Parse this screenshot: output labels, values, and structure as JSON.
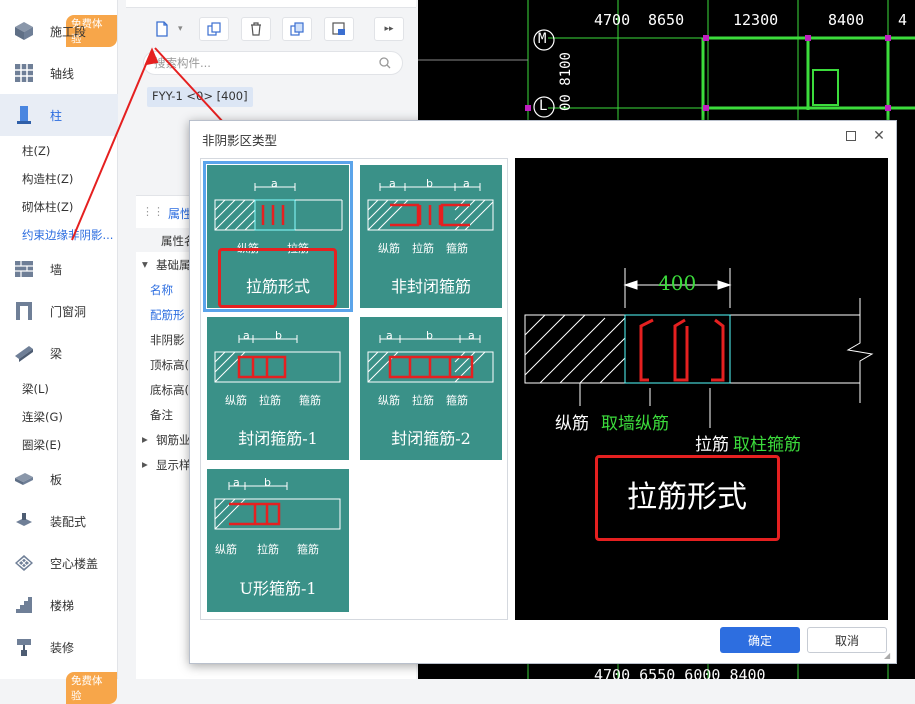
{
  "nav": {
    "badge_top": "免费体验",
    "badge_bottom": "免费体验",
    "items": [
      {
        "label": "施工段",
        "icon": "construction-section-icon"
      },
      {
        "label": "轴线",
        "icon": "axis-grid-icon"
      },
      {
        "label": "柱",
        "icon": "column-icon"
      },
      {
        "label": "墙",
        "icon": "wall-icon"
      },
      {
        "label": "门窗洞",
        "icon": "door-window-icon"
      },
      {
        "label": "梁",
        "icon": "beam-icon"
      },
      {
        "label": "板",
        "icon": "slab-icon"
      },
      {
        "label": "装配式",
        "icon": "prefab-icon"
      },
      {
        "label": "空心楼盖",
        "icon": "hollow-floor-icon"
      },
      {
        "label": "楼梯",
        "icon": "stairs-icon"
      },
      {
        "label": "装修",
        "icon": "decoration-icon"
      }
    ],
    "column_subs": [
      "柱(Z)",
      "构造柱(Z)",
      "砌体柱(Z)",
      "约束边缘非阴影..."
    ],
    "beam_subs": [
      "梁(L)",
      "连梁(G)",
      "圈梁(E)"
    ]
  },
  "mid": {
    "search_placeholder": "搜索构件...",
    "tree_item": "FYY-1 <0> [400]",
    "props_tab": "属性",
    "props_header": "属性名",
    "group_basic": "基础属",
    "props": [
      "名称",
      "配筋形",
      "非阴影",
      "顶标高(",
      "底标高(",
      "备注"
    ],
    "group_rebar": "钢筋业",
    "group_display": "显示样"
  },
  "cad": {
    "top_numbers": [
      "4700",
      "8650",
      "12300",
      "8400",
      "4"
    ],
    "bottom_numbers": "4700 6550 6000 8400",
    "axis_m": "M",
    "axis_l": "L",
    "vertical_num": "00 8100"
  },
  "dialog": {
    "title": "非阴影区类型",
    "cards": [
      {
        "title": "拉筋形式",
        "subs": [
          "纵筋",
          "拉筋"
        ]
      },
      {
        "title": "非封闭箍筋",
        "subs": [
          "纵筋",
          "拉筋",
          "箍筋"
        ]
      },
      {
        "title": "封闭箍筋-1",
        "subs": [
          "纵筋",
          "拉筋",
          "箍筋"
        ]
      },
      {
        "title": "封闭箍筋-2",
        "subs": [
          "纵筋",
          "拉筋",
          "箍筋"
        ]
      },
      {
        "title": "U形箍筋-1",
        "subs": [
          "纵筋",
          "拉筋",
          "箍筋"
        ]
      }
    ],
    "dim_a": "a",
    "dim_b": "b",
    "preview": {
      "dimension": "400",
      "label_long": "纵筋",
      "label_long_desc": "取墙纵筋",
      "label_tie": "拉筋",
      "label_tie_desc": "取柱箍筋",
      "big_title": "拉筋形式"
    },
    "ok": "确定",
    "cancel": "取消"
  },
  "colors": {
    "accent": "#2d6ee0",
    "card_bg": "#3a9188",
    "annotation_red": "#e52020",
    "cad_green": "#3cdc3c"
  }
}
